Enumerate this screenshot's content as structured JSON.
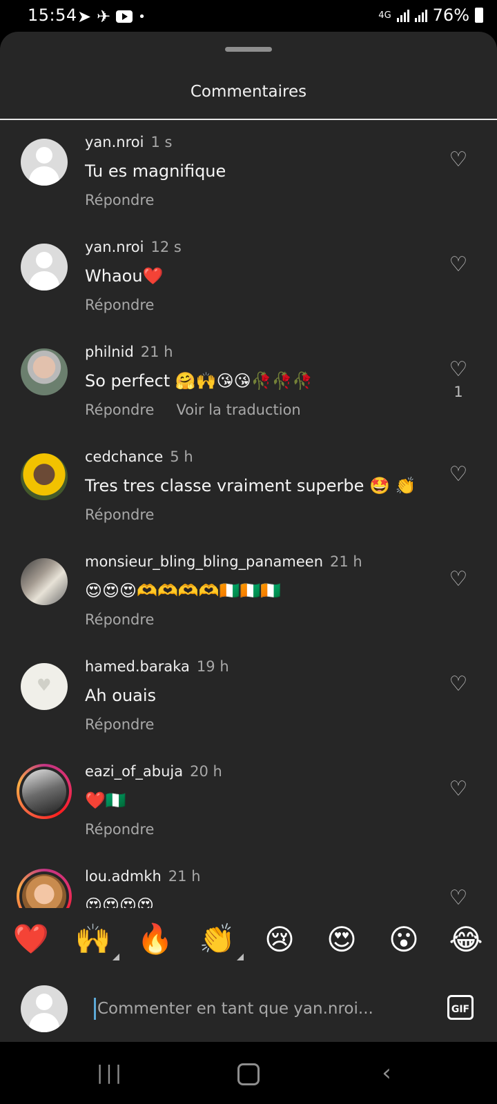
{
  "status_bar": {
    "time": "15:54",
    "network": "4G",
    "battery": "76%"
  },
  "sheet": {
    "title": "Commentaires"
  },
  "comments": [
    {
      "username": "yan.nroi",
      "time": "1 s",
      "text": "Tu es magnifique",
      "reply": "Répondre",
      "translate": "",
      "likes": ""
    },
    {
      "username": "yan.nroi",
      "time": "12 s",
      "text": "Whaou❤️",
      "reply": "Répondre",
      "translate": "",
      "likes": ""
    },
    {
      "username": "philnid",
      "time": "21 h",
      "text": "So perfect 🤗🙌😘😘🥀🥀🥀",
      "reply": "Répondre",
      "translate": "Voir la traduction",
      "likes": "1"
    },
    {
      "username": "cedchance",
      "time": "5 h",
      "text": "Tres tres classe vraiment superbe 🤩 👏",
      "reply": "Répondre",
      "translate": "",
      "likes": ""
    },
    {
      "username": "monsieur_bling_bling_panameen",
      "time": "21 h",
      "text": "😍😍😍🫶🫶🫶🫶🇨🇮🇨🇮🇨🇮",
      "reply": "Répondre",
      "translate": "",
      "likes": ""
    },
    {
      "username": "hamed.baraka",
      "time": "19 h",
      "text": "Ah ouais",
      "reply": "Répondre",
      "translate": "",
      "likes": ""
    },
    {
      "username": "eazi_of_abuja",
      "time": "20 h",
      "text": "❤️🇳🇬",
      "reply": "Répondre",
      "translate": "",
      "likes": ""
    },
    {
      "username": "lou.admkh",
      "time": "21 h",
      "text": "😍😍😍😍",
      "reply": "",
      "translate": "",
      "likes": ""
    }
  ],
  "reactions": [
    "❤️",
    "🙌",
    "🔥",
    "👏",
    "😢",
    "😍",
    "😮",
    "😂"
  ],
  "composer": {
    "placeholder": "Commenter en tant que yan.nroi...",
    "gif_label": "GIF"
  },
  "icons": {
    "heart": "heart-outline-icon",
    "send": "send-icon",
    "telegram": "telegram-icon",
    "youtube": "youtube-icon"
  }
}
